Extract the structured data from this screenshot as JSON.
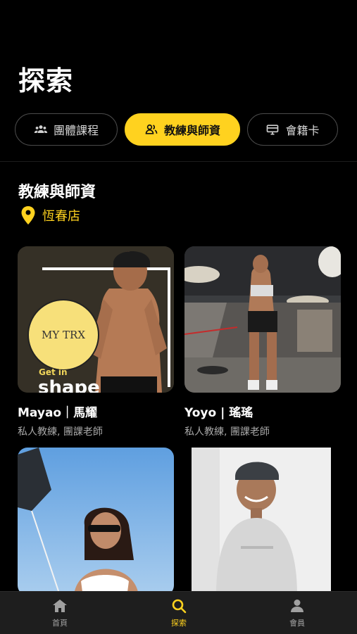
{
  "header": {
    "title": "探索"
  },
  "tabs": [
    {
      "label": "團體課程",
      "icon": "group-icon",
      "active": false
    },
    {
      "label": "教練與師資",
      "icon": "coach-icon",
      "active": true
    },
    {
      "label": "會籍卡",
      "icon": "card-icon",
      "active": false
    }
  ],
  "section": {
    "title": "教練與師資",
    "location": "恆春店"
  },
  "coaches": [
    {
      "name": "Mayao｜馬耀",
      "role": "私人教練, 團課老師",
      "photo_text": [
        "MY TRX",
        "Get in",
        "shape"
      ]
    },
    {
      "name": "Yoyo | 瑤瑤",
      "role": "私人教練, 團課老師"
    },
    {
      "name": "",
      "role": ""
    },
    {
      "name": "",
      "role": ""
    }
  ],
  "bottom_nav": [
    {
      "label": "首頁",
      "icon": "home-icon",
      "active": false
    },
    {
      "label": "探索",
      "icon": "search-icon",
      "active": true
    },
    {
      "label": "會員",
      "icon": "person-icon",
      "active": false
    }
  ],
  "colors": {
    "accent": "#ffd21f",
    "background": "#000000",
    "nav_background": "#1e1e1e"
  }
}
